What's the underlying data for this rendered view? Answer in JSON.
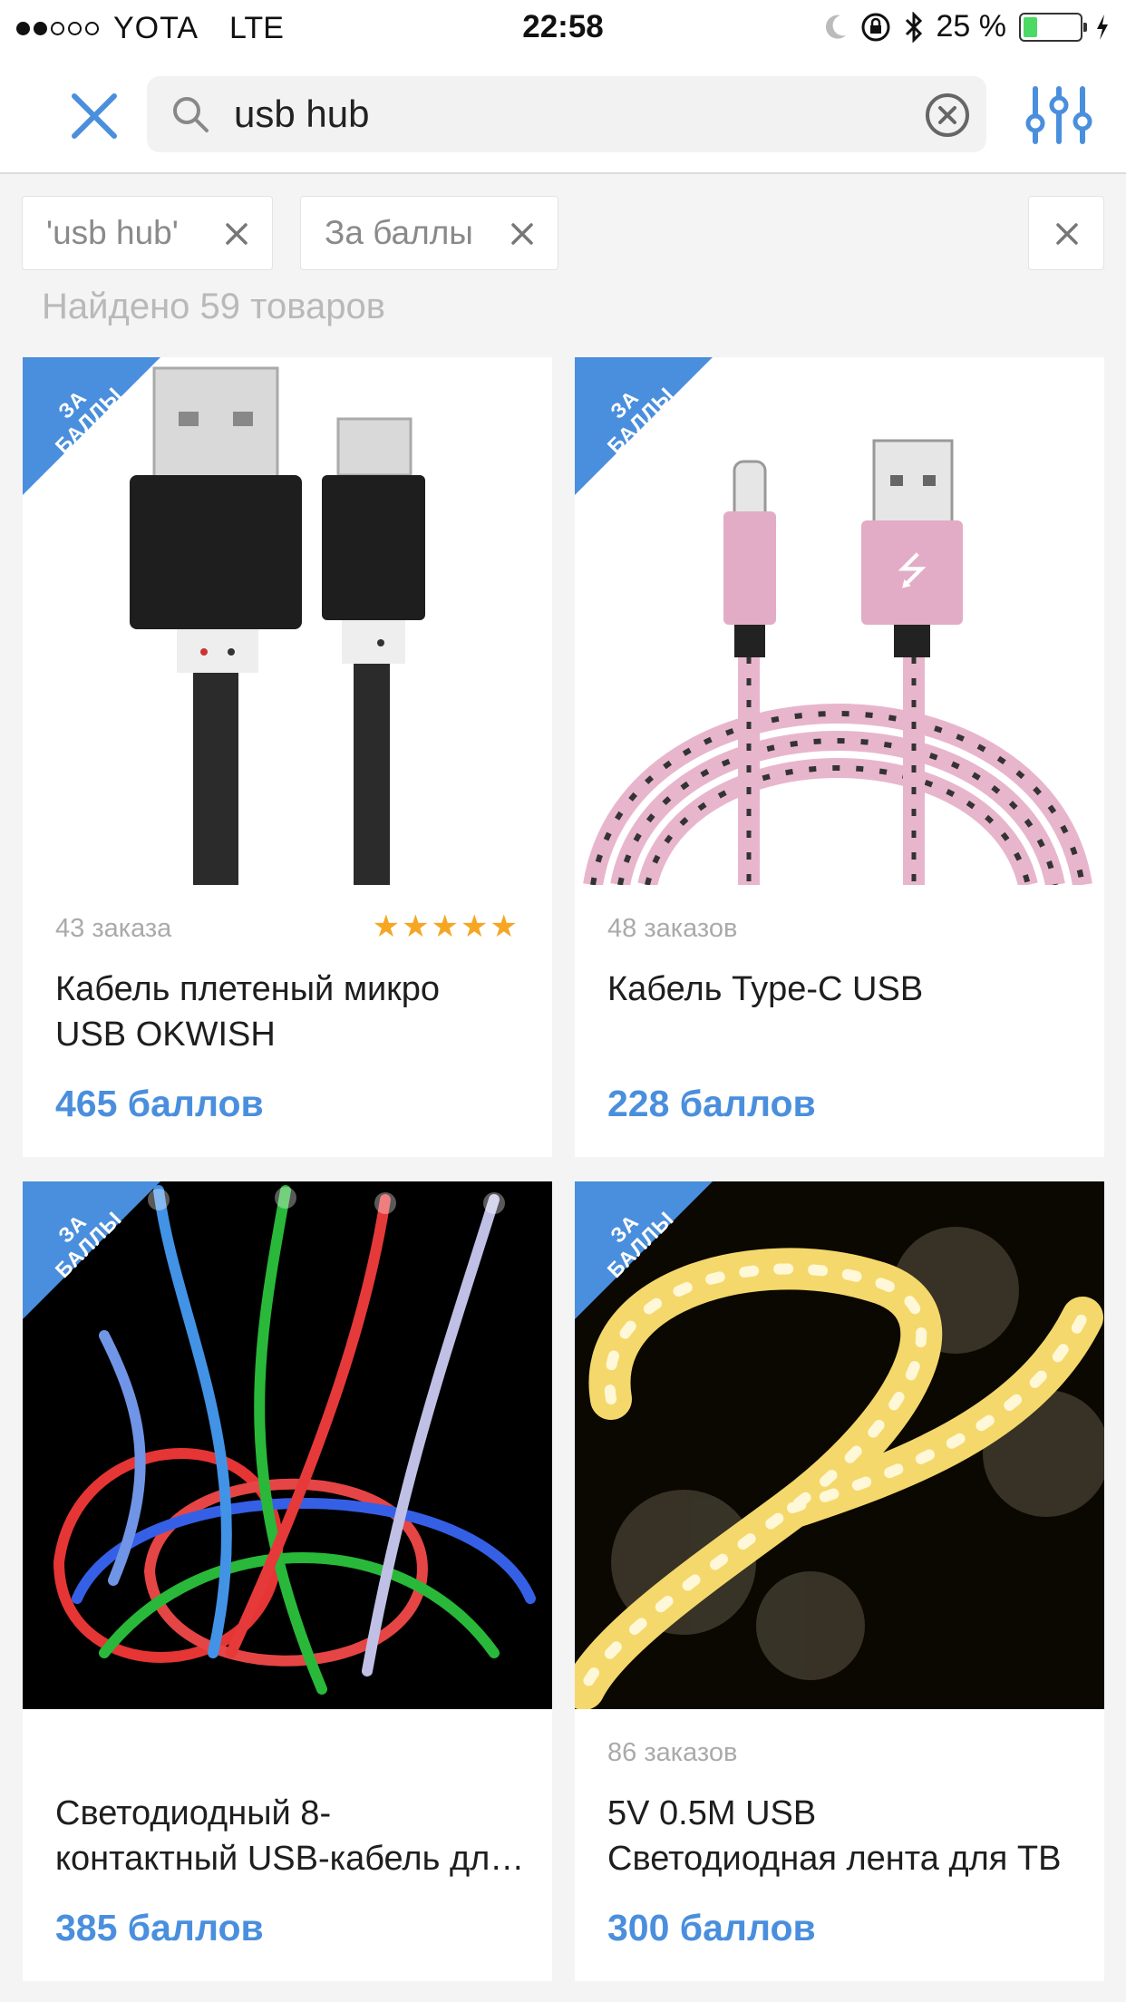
{
  "status_bar": {
    "carrier": "YOTA",
    "network": "LTE",
    "time": "22:58",
    "battery": "25 %",
    "battery_level": 0.25
  },
  "search": {
    "query": "usb hub",
    "placeholder": ""
  },
  "filters": {
    "chips": [
      "'usb hub'",
      "За баллы"
    ]
  },
  "results": {
    "found_text": "Найдено 59 товаров"
  },
  "badge_label": "ЗА БАЛЛЫ",
  "colors": {
    "accent": "#4a8fdd",
    "stars": "#f6a623",
    "badge": "#4a8fdd"
  },
  "products": [
    {
      "orders": "43 заказа",
      "rating": 5,
      "title_lines": [
        "Кабель плетеный микро",
        "USB OKWISH"
      ],
      "price": "465 баллов",
      "image": "black-micro-usb-cable"
    },
    {
      "orders": "48 заказов",
      "title_lines": [
        "Кабель Type-C USB"
      ],
      "price": "228 баллов",
      "image": "pink-type-c-cable"
    },
    {
      "orders": "",
      "title_lines": [
        "Светодиодный 8-",
        "контактный USB-кабель для iPhone"
      ],
      "price": "385 баллов",
      "image": "led-glowing-cables"
    },
    {
      "orders": "86 заказов",
      "title_lines": [
        "5V 0.5M USB",
        "Светодиодная лента для ТВ"
      ],
      "price": "300 баллов",
      "image": "led-strip-light"
    }
  ]
}
